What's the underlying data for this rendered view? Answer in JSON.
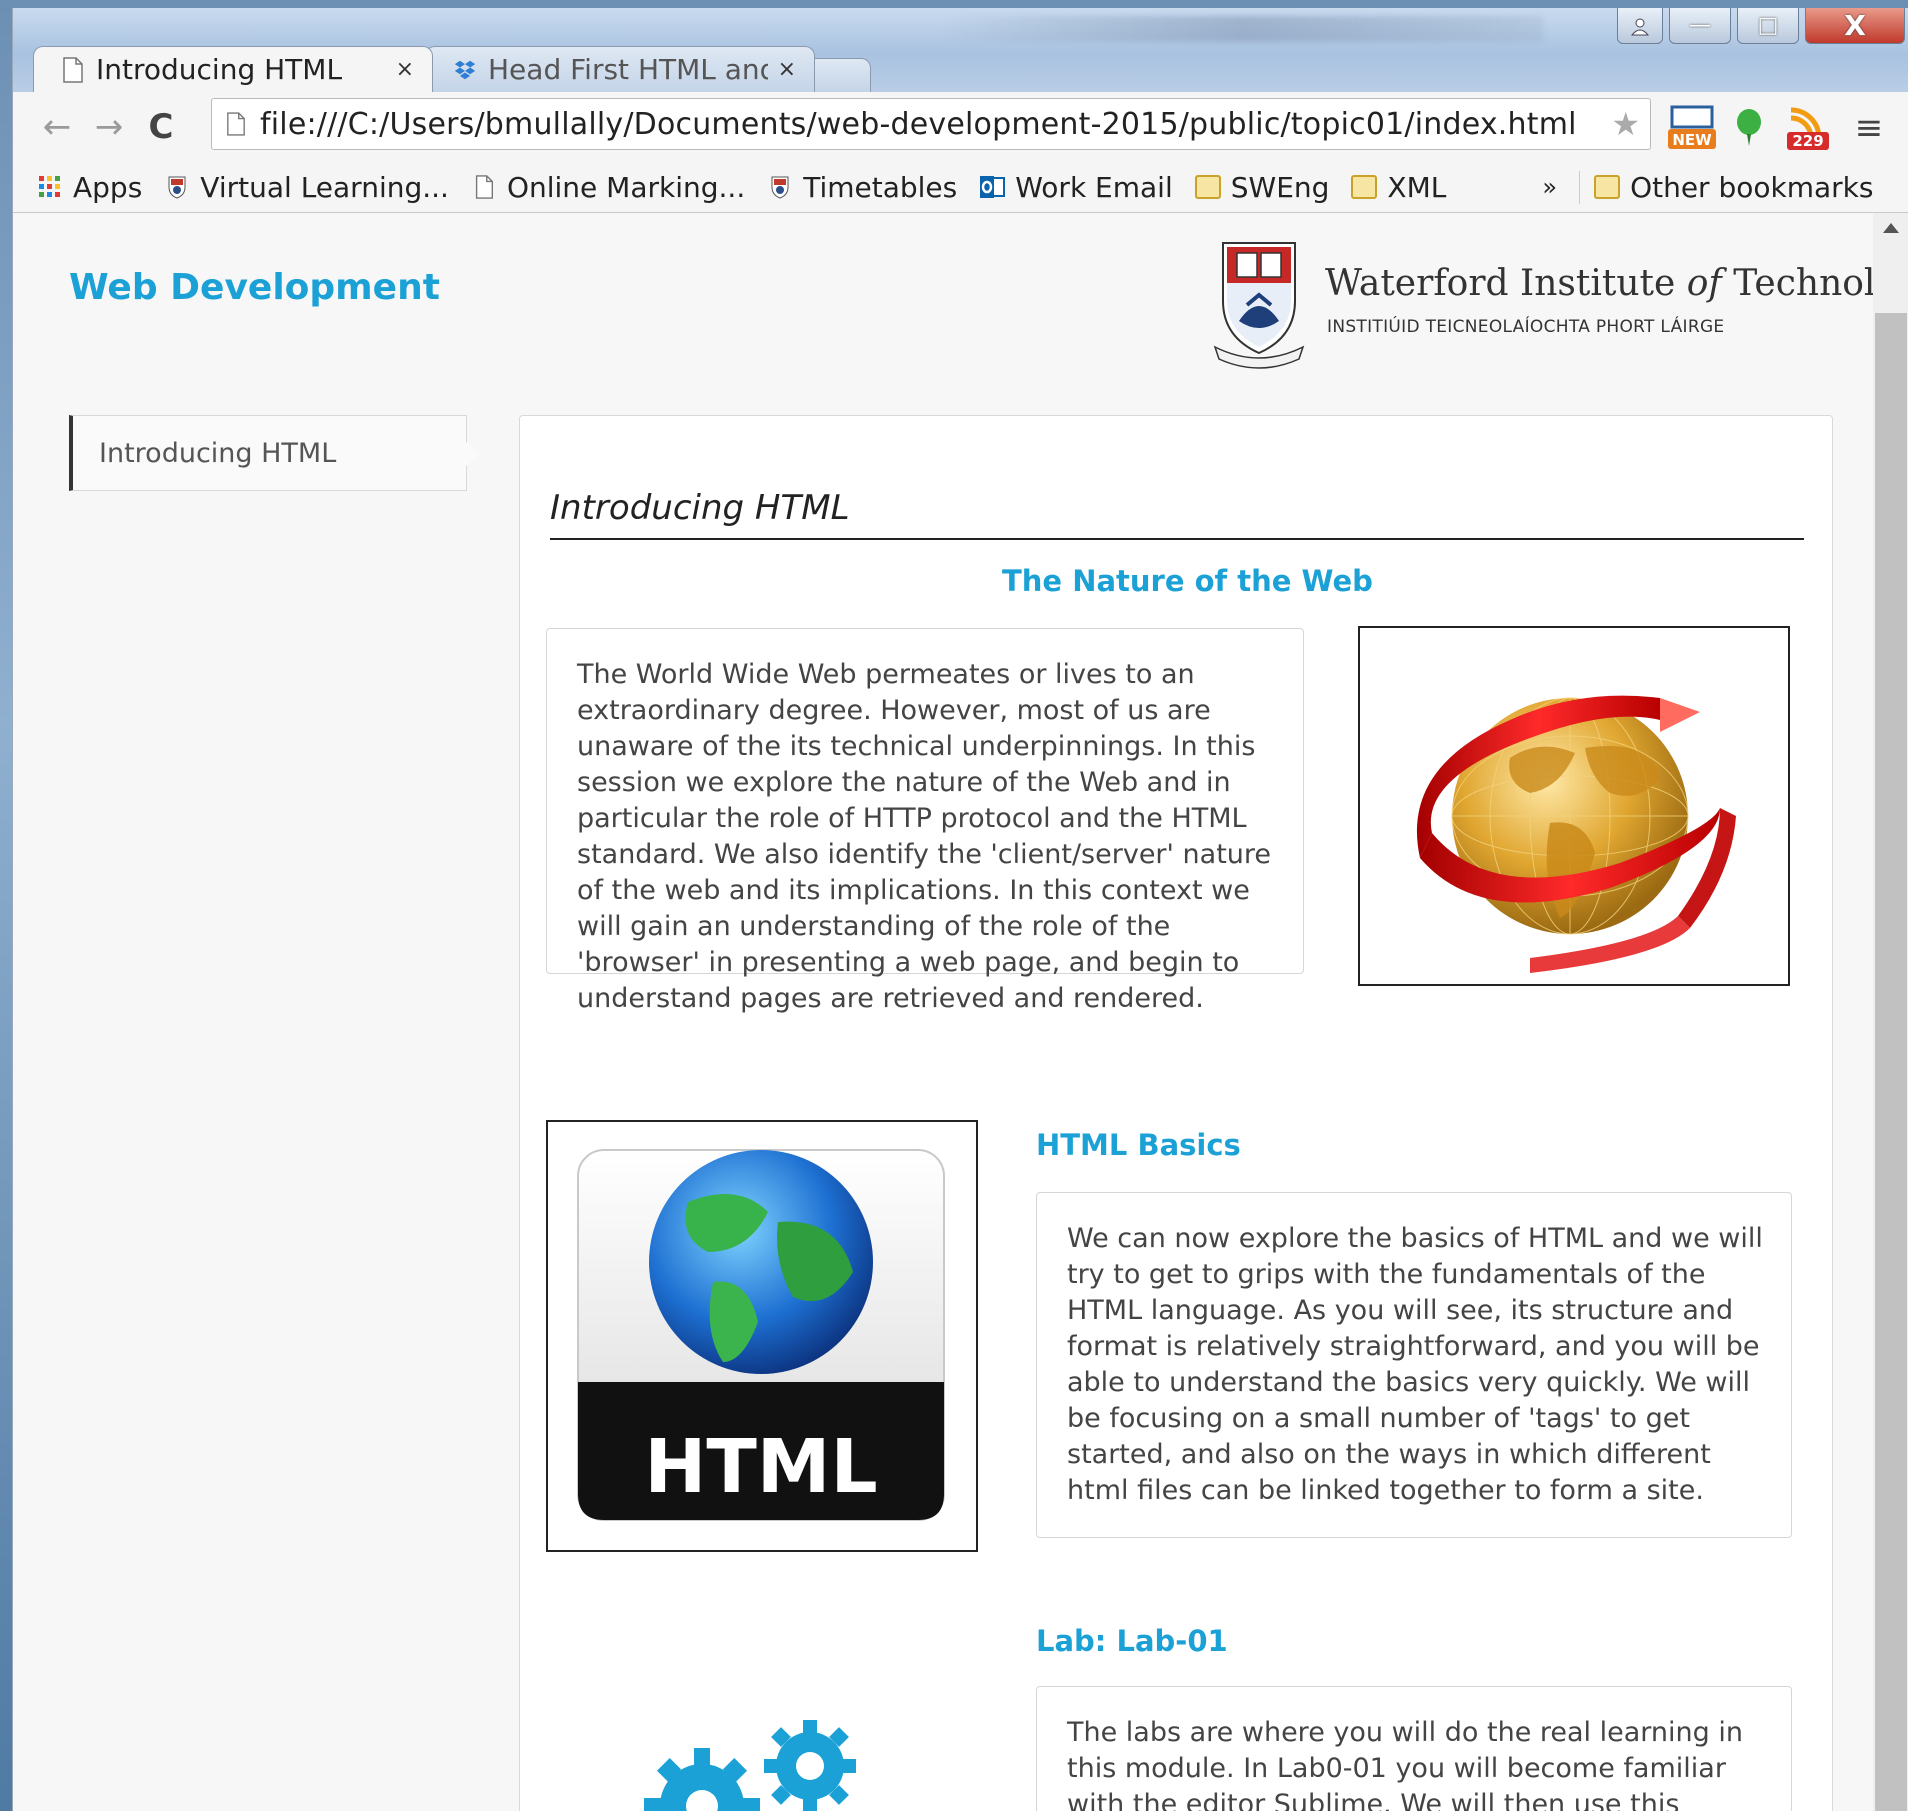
{
  "browser": {
    "tabs": [
      {
        "label": "Introducing HTML",
        "close": "×"
      },
      {
        "label": "Head First HTML and",
        "close": "×"
      }
    ],
    "url": "file:///C:/Users/bmullally/Documents/web-development-2015/public/topic01/index.html",
    "extensions": {
      "new_badge": "NEW",
      "rss_count": "229"
    },
    "bookmarks": [
      {
        "label": "Apps",
        "icon": "apps-grid-icon"
      },
      {
        "label": "Virtual Learning...",
        "icon": "wit-crest-icon"
      },
      {
        "label": "Online Marking...",
        "icon": "page-icon"
      },
      {
        "label": "Timetables",
        "icon": "wit-crest-icon"
      },
      {
        "label": "Work Email",
        "icon": "outlook-icon"
      },
      {
        "label": "SWEng",
        "icon": "folder-icon"
      },
      {
        "label": "XML",
        "icon": "folder-icon"
      }
    ],
    "bookmarks_overflow": "»",
    "other_bookmarks": "Other bookmarks",
    "window_controls": {
      "minimize": "—",
      "maximize": "□",
      "close": "X"
    }
  },
  "page": {
    "brand": "Web Development",
    "institute": {
      "name_pre": "Waterford Institute ",
      "name_of": "of",
      "name_post": " Technology",
      "subtitle": "INSTITIÚID TEICNEOLAÍOCHTA PHORT LÁIRGE"
    },
    "side_nav": {
      "item": "Introducing HTML"
    },
    "heading": "Introducing HTML",
    "sections": [
      {
        "title": "The Nature of the Web",
        "text": "The World Wide Web permeates or lives to an extraordinary degree. However, most of us are unaware of the its technical underpinnings. In this session we explore the nature of the Web and in particular the role of HTTP protocol and the HTML standard. We also identify the 'client/server' nature of the web and its implications. In this context we will gain an understanding of the role of the 'browser' in presenting a web page, and begin to understand pages are retrieved and rendered."
      },
      {
        "title": "HTML Basics",
        "text": "We can now explore the basics of HTML and we will try to get to grips with the fundamentals of the HTML language. As you will see, its structure and format is relatively straightforward, and you will be able to understand the basics very quickly. We will be focusing on a small number of 'tags' to get started, and also on the ways in which different html files can be linked together to form a site.",
        "image_label": "HTML"
      },
      {
        "title": "Lab: Lab-01",
        "text": "The labs are where you will do the real learning in this module. In Lab0-01 you will become familiar with the editor Sublime. We will then use this editor to"
      }
    ]
  },
  "colors": {
    "accent": "#1ba1d6",
    "text": "#444444",
    "heading": "#222222"
  }
}
